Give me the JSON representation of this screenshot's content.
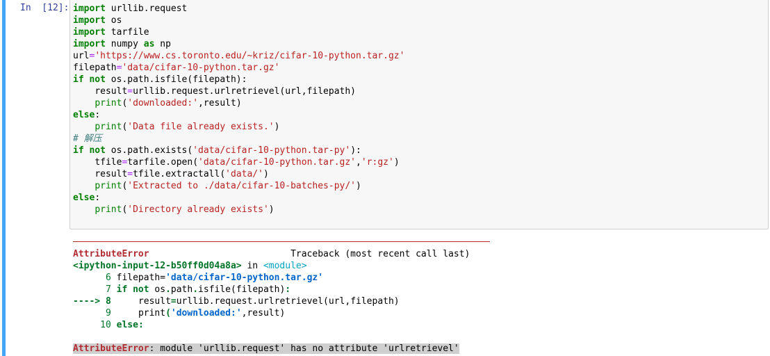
{
  "prompt": {
    "label": "In  [12]:"
  },
  "code": {
    "line1_kw": "import",
    "line1_rest": " urllib.request",
    "line2_kw": "import",
    "line2_rest": " os",
    "line3_kw": "import",
    "line3_rest": " tarfile",
    "line4_kw": "import",
    "line4_mid": " numpy ",
    "line4_as": "as",
    "line4_rest": " np",
    "line5_a": "url",
    "line5_eq": "=",
    "line5_str": "'https://www.cs.toronto.edu/~kriz/cifar-10-python.tar.gz'",
    "line6_a": "filepath",
    "line6_eq": "=",
    "line6_str": "'data/cifar-10-python.tar.gz'",
    "line7_if": "if",
    "line7_not": "not",
    "line7_rest": " os.path.isfile(filepath):",
    "line8_indent": "    ",
    "line8_a": "result",
    "line8_eq": "=",
    "line8_rest": "urllib.request.urlretrievel(url,filepath)",
    "line9_indent": "    ",
    "line9_print": "print",
    "line9_open": "(",
    "line9_str": "'downloaded:'",
    "line9_rest": ",result)",
    "line10_else": "else",
    "line10_colon": ":",
    "line11_indent": "    ",
    "line11_print": "print",
    "line11_open": "(",
    "line11_str": "'Data file already exists.'",
    "line11_close": ")",
    "line12_comment": "# 解压",
    "line13_if": "if",
    "line13_not": "not",
    "line13_mid": " os.path.exists(",
    "line13_str": "'data/cifar-10-python.tar-py'",
    "line13_close": "):",
    "line14_indent": "    ",
    "line14_a": "tfile",
    "line14_eq": "=",
    "line14_mid": "tarfile.open(",
    "line14_str1": "'data/cifar-10-python.tar.gz'",
    "line14_comma": ",",
    "line14_str2": "'r:gz'",
    "line14_close": ")",
    "line15_indent": "    ",
    "line15_a": "result",
    "line15_eq": "=",
    "line15_mid": "tfile.extractall(",
    "line15_str": "'data/'",
    "line15_close": ")",
    "line16_indent": "    ",
    "line16_print": "print",
    "line16_open": "(",
    "line16_str": "'Extracted to ./data/cifar-10-batches-py/'",
    "line16_close": ")",
    "line17_else": "else",
    "line17_colon": ":",
    "line18_indent": "    ",
    "line18_print": "print",
    "line18_open": "(",
    "line18_str": "'Directory already exists'",
    "line18_close": ")"
  },
  "traceback": {
    "error_name": "AttributeError",
    "header_spacer": "                          ",
    "header_right": "Traceback (most recent call last)",
    "input_ref": "<ipython-input-12-b50ff0d04a8a>",
    "in_word": " in ",
    "module": "<module>",
    "l6_num": "      6 ",
    "l6_a": "filepath",
    "l6_eq": "=",
    "l6_str": "'data/cifar-10-python.tar.gz'",
    "l7_num": "      7 ",
    "l7_if": "if",
    "l7_not": "not",
    "l7_mid": " os",
    "l7_dot1": ".",
    "l7_path": "path",
    "l7_dot2": ".",
    "l7_rest": "isfile(filepath)",
    "l7_colon": ":",
    "l8_arrow": "----> 8",
    "l8_indent": "     ",
    "l8_a": "result",
    "l8_eq": "=",
    "l8_rest": "urllib.request.urlretrievel(url,filepath)",
    "l9_num": "      9 ",
    "l9_indent": "    ",
    "l9_print": "print",
    "l9_open": "(",
    "l9_str": "'downloaded:'",
    "l9_rest": ",result)",
    "l10_num": "     10 ",
    "l10_else": "else",
    "l10_colon": ":",
    "final_name": "AttributeError",
    "final_msg": ": module 'urllib.request' has no attribute 'urlretrievel'"
  },
  "colors": {
    "selection_bar": "#42a5f5",
    "prompt": "#303f9f",
    "keyword": "#008000",
    "string": "#ba2121",
    "comment": "#408080",
    "operator": "#aa22ff",
    "error": "#b22b31"
  }
}
